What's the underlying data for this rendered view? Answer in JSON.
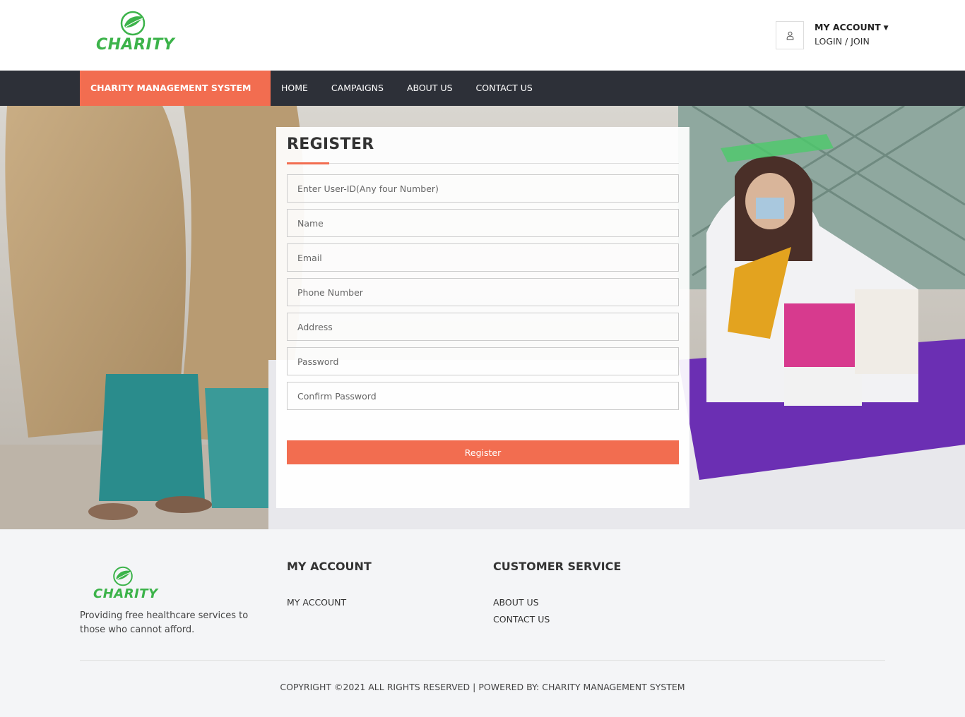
{
  "header": {
    "logo_text": "CHARITY",
    "account_title": "MY ACCOUNT",
    "account_login": "LOGIN / JOIN"
  },
  "nav": {
    "brand": "CHARITY MANAGEMENT SYSTEM",
    "links": [
      "HOME",
      "CAMPAIGNS",
      "ABOUT US",
      "CONTACT US"
    ]
  },
  "register": {
    "title": "REGISTER",
    "fields": [
      "Enter User-ID(Any four Number)",
      "Name",
      "Email",
      "Phone Number",
      "Address",
      "Password",
      "Confirm Password"
    ],
    "button": "Register"
  },
  "footer": {
    "logo_text": "CHARITY",
    "description": "Providing free healthcare services to those who cannot afford.",
    "my_account": {
      "heading": "MY ACCOUNT",
      "links": [
        "MY ACCOUNT"
      ]
    },
    "customer_service": {
      "heading": "CUSTOMER SERVICE",
      "links": [
        "ABOUT US",
        "CONTACT US"
      ]
    },
    "copyright": "COPYRIGHT ©2021 ALL RIGHTS RESERVED | POWERED BY: CHARITY MANAGEMENT SYSTEM"
  },
  "colors": {
    "accent": "#f26d50",
    "nav_bg": "#2d3038",
    "logo_green": "#3cb34a",
    "footer_bg": "#f4f5f7"
  },
  "icons": {
    "logo": "leaf-globe-icon",
    "account": "user-icon",
    "caret": "caret-down-icon"
  }
}
